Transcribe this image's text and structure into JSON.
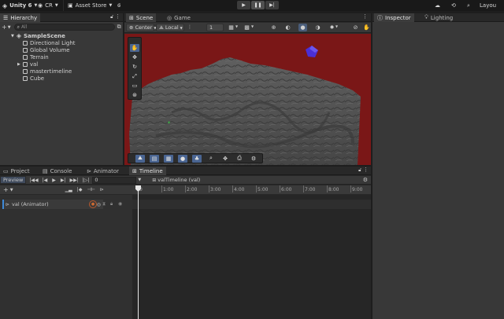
{
  "topbar": {
    "unity_label": "Unity 6",
    "account_label": "CR",
    "asset_store_label": "Asset Store",
    "layout_label": "Layou"
  },
  "hierarchy": {
    "tab_label": "Hierarchy",
    "search_placeholder": "All",
    "scene_name": "SampleScene",
    "items": [
      {
        "label": "Directional Light"
      },
      {
        "label": "Global Volume"
      },
      {
        "label": "Terrain"
      },
      {
        "label": "val"
      },
      {
        "label": "mastertimeline"
      },
      {
        "label": "Cube"
      }
    ]
  },
  "scene_view": {
    "tabs": [
      {
        "label": "Scene"
      },
      {
        "label": "Game"
      }
    ],
    "pivot_label": "Center",
    "space_label": "Local",
    "grid_snap_value": "1",
    "background_color": "#7a1717"
  },
  "inspector": {
    "tabs": [
      {
        "label": "Inspector"
      },
      {
        "label": "Lighting"
      }
    ]
  },
  "bottom": {
    "tabs": [
      {
        "label": "Project"
      },
      {
        "label": "Console"
      },
      {
        "label": "Animator"
      },
      {
        "label": "Timeline"
      }
    ]
  },
  "timeline": {
    "preview_label": "Preview",
    "frame_value": "0",
    "asset_label": "valTimeline (val)",
    "track_label": "val (Animator)",
    "ruler_ticks": [
      "0",
      "1:00",
      "2:00",
      "3:00",
      "4:00",
      "5:00",
      "6:00",
      "7:00",
      "8:00",
      "9:00"
    ]
  }
}
